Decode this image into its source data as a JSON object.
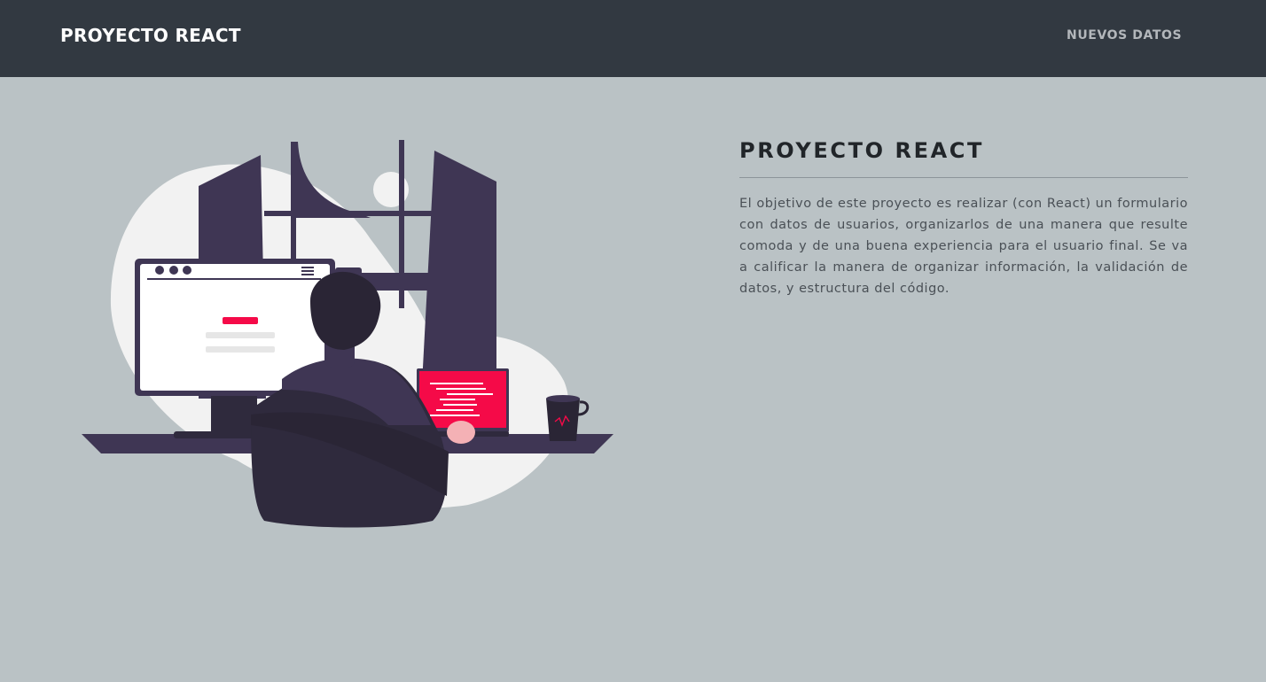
{
  "navbar": {
    "brand": "PROYECTO REACT",
    "link_nuevos_datos": "NUEVOS DATOS"
  },
  "main": {
    "title": "PROYECTO REACT",
    "description": "El objetivo de este proyecto es realizar (con React) un formulario con datos de usuarios, organizarlos de una manera que resulte comoda y de una buena experiencia para el usuario final. Se va a calificar la manera de organizar información, la validación de datos, y estructura del código."
  },
  "illustration": {
    "icon": "developer-at-desk-illustration",
    "colors": {
      "dark_purple": "#3f3654",
      "darker_purple": "#2a2535",
      "accent_red": "#f50a48",
      "blob": "#f2f2f2",
      "skin": "#f4b1b5"
    }
  },
  "theme": {
    "navbar_bg": "#323941",
    "page_bg": "#bac2c5",
    "brand_color": "#ffffff",
    "nav_link_color": "#b3b7bb"
  }
}
